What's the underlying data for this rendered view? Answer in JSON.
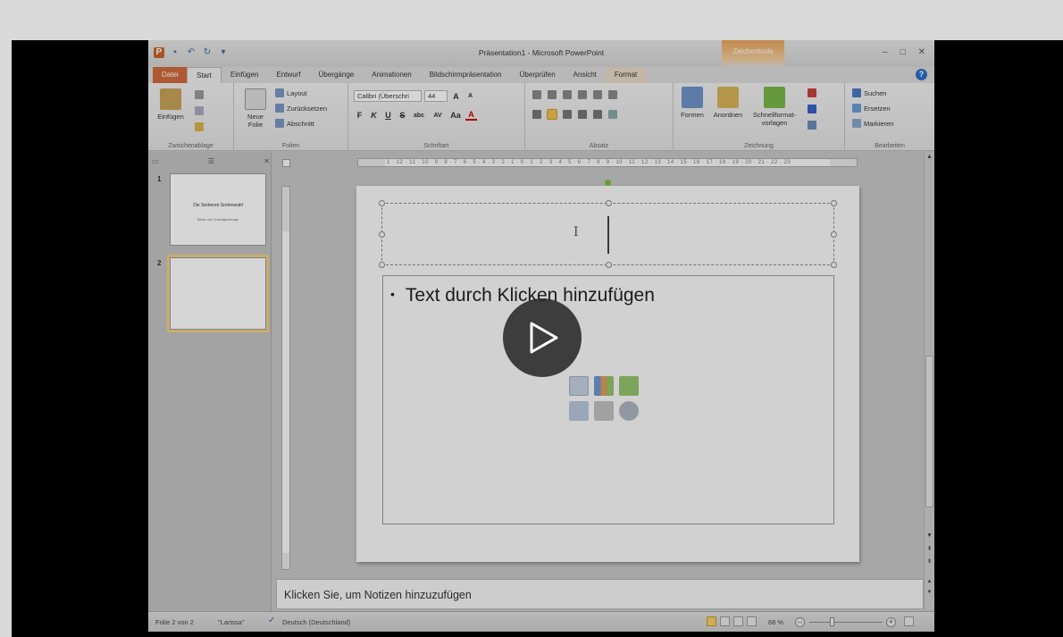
{
  "window": {
    "title": "Präsentation1 - Microsoft PowerPoint",
    "context_tool": "Zeichentools",
    "controls": [
      "–",
      "□",
      "✕"
    ]
  },
  "qat": {
    "logo": "P",
    "save": "▪",
    "undo": "↶",
    "redo": "↻",
    "more": "▾"
  },
  "tabs": [
    {
      "label": "Datei"
    },
    {
      "label": "Start"
    },
    {
      "label": "Einfügen"
    },
    {
      "label": "Entwurf"
    },
    {
      "label": "Übergänge"
    },
    {
      "label": "Animationen"
    },
    {
      "label": "Bildschirmpräsentation"
    },
    {
      "label": "Überprüfen"
    },
    {
      "label": "Ansicht"
    },
    {
      "label": "Format"
    }
  ],
  "active_tab": "Start",
  "ribbon": {
    "clipboard": {
      "paste": "Einfügen",
      "label": "Zwischenablage"
    },
    "slides": {
      "new_slide": "Neue Folie",
      "layout": "Layout",
      "reset": "Zurücksetzen",
      "section": "Abschnitt",
      "label": "Folien"
    },
    "font": {
      "family": "Calibri (Überschri",
      "size": "44",
      "label": "Schriftart",
      "bold": "F",
      "italic": "K",
      "underline": "U",
      "strike": "S",
      "shadow": "abc",
      "spacing": "AV",
      "case": "Aa",
      "color": "A"
    },
    "paragraph": {
      "label": "Absatz"
    },
    "drawing": {
      "shapes": "Formen",
      "arrange": "Anordnen",
      "quick_styles": "Schnellformat-vorlagen",
      "label": "Zeichnung"
    },
    "editing": {
      "find": "Suchen",
      "replace": "Ersetzen",
      "select": "Markieren",
      "label": "Bearbeiten"
    }
  },
  "slides_pane": {
    "thumbnails": [
      {
        "number": "1",
        "title": "Die Sortieren Sortenwahl",
        "subtitle": "Bilder der Vortragsvorlage"
      },
      {
        "number": "2",
        "title": "",
        "subtitle": ""
      }
    ]
  },
  "ruler": {
    "h_text": "1 · 12 · 11 · 10 · 9 · 8 · 7 · 6 · 5 · 4 · 3 · 2 · 1 · 0 · 1 · 2 · 3 · 4 · 5 · 6 · 7 · 8 · 9 · 10 · 11 · 12 · 13 · 14 · 15 · 16 · 17 · 18 · 19 · 20 · 21 · 22 · 23"
  },
  "slide": {
    "body_placeholder": "Text durch Klicken hinzufügen",
    "insert_icons": [
      "table-icon",
      "chart-icon",
      "smartart-icon",
      "picture-icon",
      "clipart-icon",
      "media-icon"
    ]
  },
  "notes": {
    "placeholder": "Klicken Sie, um Notizen hinzuzufügen"
  },
  "status": {
    "slide_info": "Folie 2 von 2",
    "theme": "\"Larissa\"",
    "language": "Deutsch (Deutschland)",
    "zoom": "68 %"
  },
  "colors": {
    "file_tab": "#d1693b",
    "context_tool": "#e7a45a",
    "selection": "#f0cf84",
    "accent": "#2b6fc8"
  }
}
